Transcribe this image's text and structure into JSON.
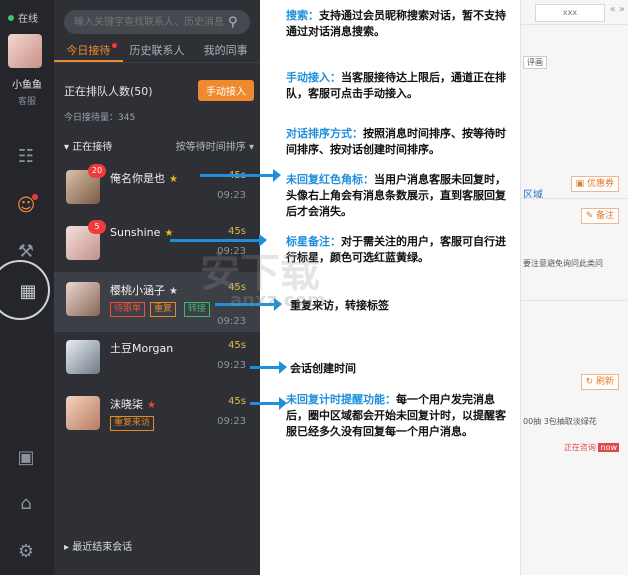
{
  "status": "在线",
  "user": {
    "name": "小鱼鱼",
    "role": "客服"
  },
  "search": {
    "placeholder": "输入关键字查找联系人、历史消息"
  },
  "tabs": [
    "今日接待",
    "历史联系人",
    "我的同事"
  ],
  "queue": {
    "label": "正在排队人数(50)",
    "manual_button": "手动接入",
    "served": "今日接待量：345"
  },
  "section": {
    "title": "正在接待",
    "sort": "按等待时间排序"
  },
  "chats": [
    {
      "name": "俺名你是也",
      "badge": "20",
      "timer": "45s",
      "time": "09:23",
      "star_color": "#e8b12a",
      "tags": []
    },
    {
      "name": "Sunshine",
      "badge": "5",
      "timer": "45s",
      "time": "09:23",
      "star_color": "#e8b12a",
      "tags": []
    },
    {
      "name": "樱桃小涵子",
      "badge": "",
      "timer": "45s",
      "time": "09:23",
      "star_color": "#dddddd",
      "tags": [
        "待跟单",
        "重复",
        "转接"
      ]
    },
    {
      "name": "土豆Morgan",
      "badge": "",
      "timer": "45s",
      "time": "09:23",
      "star_color": "",
      "tags": []
    },
    {
      "name": "沫晓柒",
      "badge": "",
      "timer": "45s",
      "time": "09:23",
      "star_color": "#e84a2a",
      "tags": [
        "重复来访"
      ]
    }
  ],
  "recent": "最近结束会话",
  "notes": [
    {
      "key": "搜索：",
      "text": "支持通过会员昵称搜索对话，暂不支持通过对话消息搜索。"
    },
    {
      "key": "手动接入：",
      "text": "当客服接待达上限后，通道正在排队，客服可点击手动接入。"
    },
    {
      "key": "对话排序方式：",
      "text": "按照消息时间排序、按等待时间排序、按对话创建时间排序。"
    },
    {
      "key": "未回复红色角标：",
      "text": "当用户消息客服未回复时，头像右上角会有消息条数展示，直到客服回复后才会消失。"
    },
    {
      "key": "标星备注：",
      "text": "对于需关注的用户，客服可自行进行标星，颜色可选红蓝黄绿。"
    },
    {
      "key": "未回复计时提醒功能：",
      "text": "每一个用户发完消息后，圈中区域都会开始未回复计时，以提醒客服已经多久没有回复每一个用户消息。"
    }
  ],
  "plain_notes": [
    "重复来访，转接标签",
    "会话创建时间"
  ],
  "side": {
    "tab": "xxx",
    "arrows": "« »",
    "text1": "评画",
    "text2": "区域",
    "coupon": "优惠券",
    "remark": "备注",
    "text3": "要注意避免询问此类问",
    "refresh": "刷新",
    "text4": "00抽 3包抽取淡绿花",
    "status": "正在咨询",
    "now": "now"
  },
  "watermark": "安下载",
  "watermark2": "anxz.com"
}
